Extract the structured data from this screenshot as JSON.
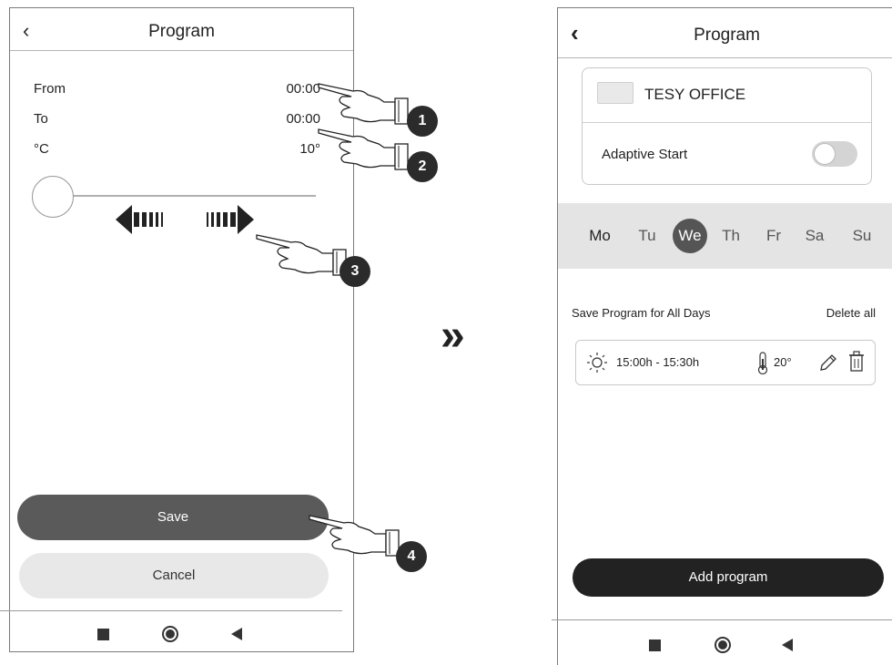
{
  "left": {
    "header": {
      "title": "Program"
    },
    "rows": [
      {
        "label": "From",
        "value": "00:00"
      },
      {
        "label": "To",
        "value": "00:00"
      },
      {
        "label": "°C",
        "value": "10°"
      }
    ],
    "buttons": {
      "save": "Save",
      "cancel": "Cancel"
    }
  },
  "badges": [
    "1",
    "2",
    "3",
    "4"
  ],
  "separator": "»",
  "right": {
    "header": {
      "title": "Program"
    },
    "device": {
      "name": "TESY OFFICE",
      "adaptive_label": "Adaptive Start",
      "adaptive_on": false
    },
    "days": [
      "Mo",
      "Tu",
      "We",
      "Th",
      "Fr",
      "Sa",
      "Su"
    ],
    "active_day": "We",
    "save_all_label": "Save Program for All Days",
    "delete_all_label": "Delete all",
    "program": {
      "time": "15:00h - 15:30h",
      "temp": "20°"
    },
    "add_program_label": "Add program"
  },
  "colors": {
    "dark": "#2b2b2b",
    "save_button": "#5a5a5a",
    "cancel_button": "#e8e8e8",
    "day_bar": "#e4e4e4"
  }
}
